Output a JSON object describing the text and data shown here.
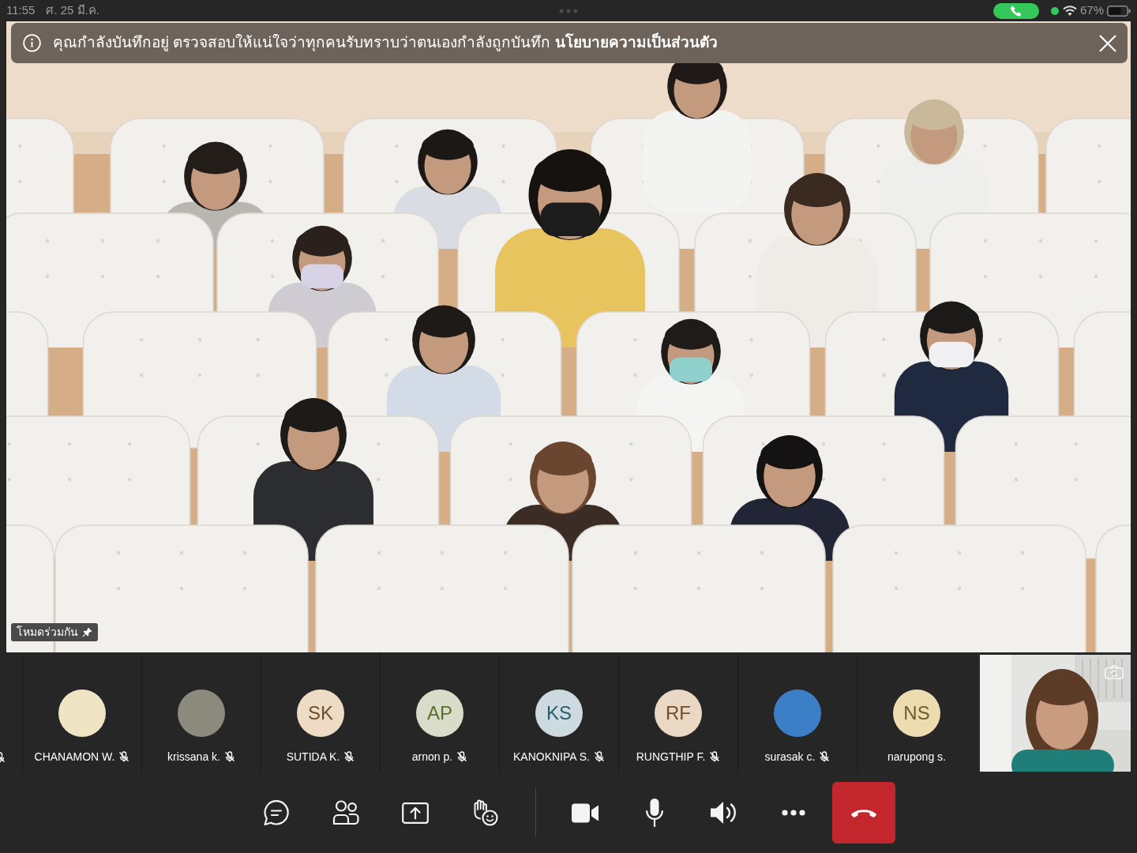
{
  "status_bar": {
    "time": "11:55",
    "date": "ศ. 25 มี.ค.",
    "battery": "67%"
  },
  "recording_banner": {
    "message": "คุณกำลังบันทึกอยู่ ตรวจสอบให้แน่ใจว่าทุกคนรับทราบว่าตนเองกำลังถูกบันทึก",
    "link": "นโยบายความเป็นส่วนตัว"
  },
  "stage": {
    "mode_label": "โหมดร่วมกัน",
    "pinned": true
  },
  "participants": [
    {
      "kind": "clipped",
      "muted": true
    },
    {
      "kind": "photo",
      "name": "CHANAMON W.",
      "muted": true,
      "color": "#efe4c4"
    },
    {
      "kind": "photo",
      "name": "krissana k.",
      "muted": true,
      "color": "#8b8a7d"
    },
    {
      "kind": "initials",
      "initials": "SK",
      "name": "SUTIDA K.",
      "muted": true,
      "color": "#eddbc6"
    },
    {
      "kind": "initials",
      "initials": "AP",
      "name": "arnon p.",
      "muted": true,
      "color": "#d8ddc9"
    },
    {
      "kind": "initials",
      "initials": "KS",
      "name": "KANOKNIPA S.",
      "muted": true,
      "color": "#cddbe1"
    },
    {
      "kind": "initials",
      "initials": "RF",
      "name": "RUNGTHIP F.",
      "muted": true,
      "color": "#ebd8c4"
    },
    {
      "kind": "photo",
      "name": "surasak c.",
      "muted": true,
      "color": "#3d7fc6"
    },
    {
      "kind": "initials",
      "initials": "NS",
      "name": "narupong s.",
      "muted": false,
      "color": "#ecdcb0"
    }
  ],
  "toolbar": {
    "meeting_tools": [
      {
        "kind": "chat"
      },
      {
        "kind": "people"
      },
      {
        "kind": "share"
      },
      {
        "kind": "reactions"
      }
    ],
    "device_controls": [
      {
        "kind": "camera",
        "on": true
      },
      {
        "kind": "mic",
        "on": true
      },
      {
        "kind": "speaker"
      },
      {
        "kind": "more"
      },
      {
        "kind": "leave"
      }
    ]
  }
}
